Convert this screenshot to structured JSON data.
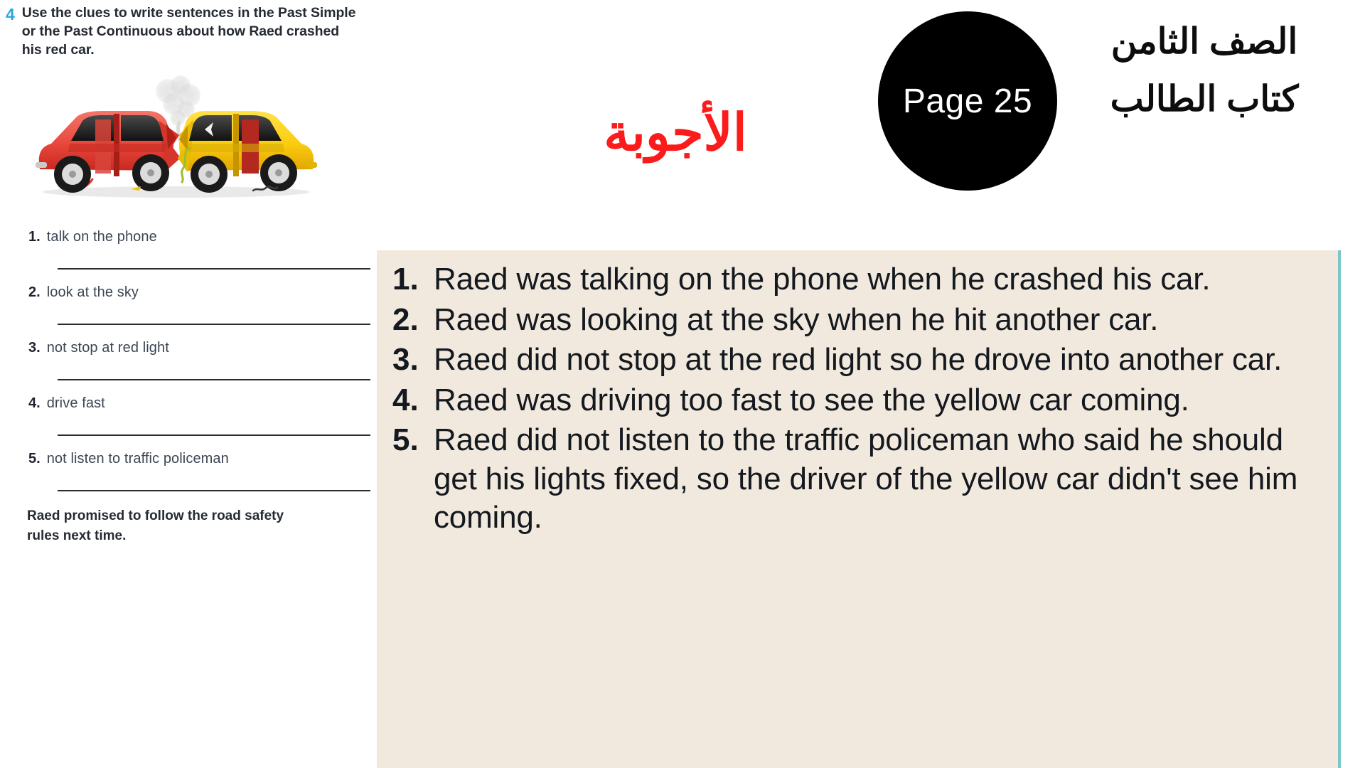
{
  "header": {
    "answers_title_ar": "الأجوبة",
    "page_badge_label": "Page 25",
    "book_meta": [
      "الصف الثامن",
      "كتاب الطالب"
    ],
    "colors": {
      "answers_title": "#FB1B1B",
      "badge_background": "#000000",
      "badge_text": "#FFFFFF",
      "panel_background": "#F1E9DD",
      "panel_edge": "#7CC6C8",
      "task_number": "#29A8E0"
    }
  },
  "workbook": {
    "task_number": "4",
    "task_instruction": "Use the clues to write sentences in the Past Simple or the Past Continuous about how Raed crashed his red car.",
    "illustration_name": "car-crash-illustration",
    "illustration_caption": "Red car and yellow car in a head-on collision with smoke",
    "clues": [
      {
        "number": "1.",
        "label": "talk on the phone"
      },
      {
        "number": "2.",
        "label": "look at the sky"
      },
      {
        "number": "3.",
        "label": "not stop at red light"
      },
      {
        "number": "4.",
        "label": "drive fast"
      },
      {
        "number": "5.",
        "label": "not listen to traffic policeman"
      }
    ],
    "closing_note": "Raed promised to follow the road safety rules next time."
  },
  "answers": [
    {
      "number": "1.",
      "text": "Raed was talking on the phone when he crashed his car."
    },
    {
      "number": "2.",
      "text": "Raed was looking at the sky when he hit another car."
    },
    {
      "number": "3.",
      "text": "Raed did not stop at the red light so he drove into another car."
    },
    {
      "number": "4.",
      "text": "Raed was driving too fast to see the yellow car coming."
    },
    {
      "number": "5.",
      "text": "Raed did not listen to the traffic policeman who said he should get his lights fixed, so the driver of the yellow car didn't see him coming."
    }
  ]
}
